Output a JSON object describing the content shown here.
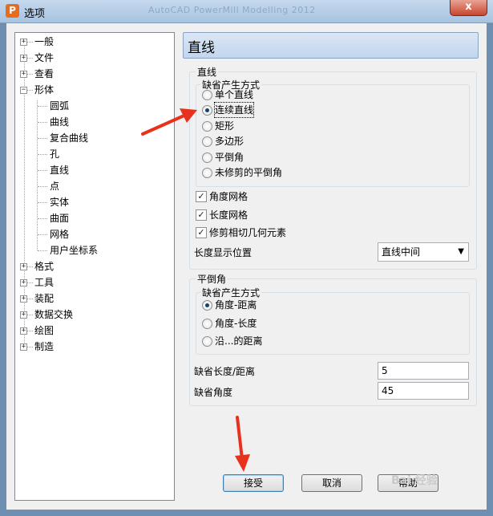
{
  "window": {
    "title": "选项",
    "app_icon": "P",
    "bg_caption": "AutoCAD PowerMill Modelling 2012",
    "close_glyph": "x"
  },
  "tree": {
    "items": [
      {
        "label": "一般",
        "expander": "+"
      },
      {
        "label": "文件",
        "expander": "+"
      },
      {
        "label": "查看",
        "expander": "+"
      },
      {
        "label": "形体",
        "expander": "−"
      },
      {
        "label": "圆弧"
      },
      {
        "label": "曲线"
      },
      {
        "label": "复合曲线"
      },
      {
        "label": "孔"
      },
      {
        "label": "直线"
      },
      {
        "label": "点"
      },
      {
        "label": "实体"
      },
      {
        "label": "曲面"
      },
      {
        "label": "网格"
      },
      {
        "label": "用户坐标系"
      },
      {
        "label": "格式",
        "expander": "+"
      },
      {
        "label": "工具",
        "expander": "+"
      },
      {
        "label": "装配",
        "expander": "+"
      },
      {
        "label": "数据交换",
        "expander": "+"
      },
      {
        "label": "绘图",
        "expander": "+"
      },
      {
        "label": "制造",
        "expander": "+"
      }
    ]
  },
  "panel": {
    "title": "直线"
  },
  "line_group": {
    "title": "直线",
    "default_mode": {
      "title": "缺省产生方式",
      "options": [
        {
          "label": "单个直线",
          "checked": false
        },
        {
          "label": "连续直线",
          "checked": true
        },
        {
          "label": "矩形",
          "checked": false
        },
        {
          "label": "多边形",
          "checked": false
        },
        {
          "label": "平倒角",
          "checked": false
        },
        {
          "label": "未修剪的平倒角",
          "checked": false
        }
      ]
    },
    "checkboxes": [
      {
        "label": "角度网格",
        "checked": true
      },
      {
        "label": "长度网格",
        "checked": true
      },
      {
        "label": "修剪相切几何元素",
        "checked": true
      }
    ],
    "length_display": {
      "label": "长度显示位置",
      "value": "直线中间",
      "arrow": "▼"
    }
  },
  "chamfer_group": {
    "title": "平倒角",
    "default_mode": {
      "title": "缺省产生方式",
      "options": [
        {
          "label": "角度-距离",
          "checked": true
        },
        {
          "label": "角度-长度",
          "checked": false
        },
        {
          "label": "沿...的距离",
          "checked": false
        }
      ]
    },
    "default_length": {
      "label": "缺省长度/距离",
      "value": "5"
    },
    "default_angle": {
      "label": "缺省角度",
      "value": "45"
    }
  },
  "buttons": {
    "accept": "接受",
    "cancel": "取消",
    "help": "帮助"
  },
  "watermark": "Bai 经验",
  "colors": {
    "arrow": "#e8321e",
    "header_bg": "#c9dbf0"
  }
}
